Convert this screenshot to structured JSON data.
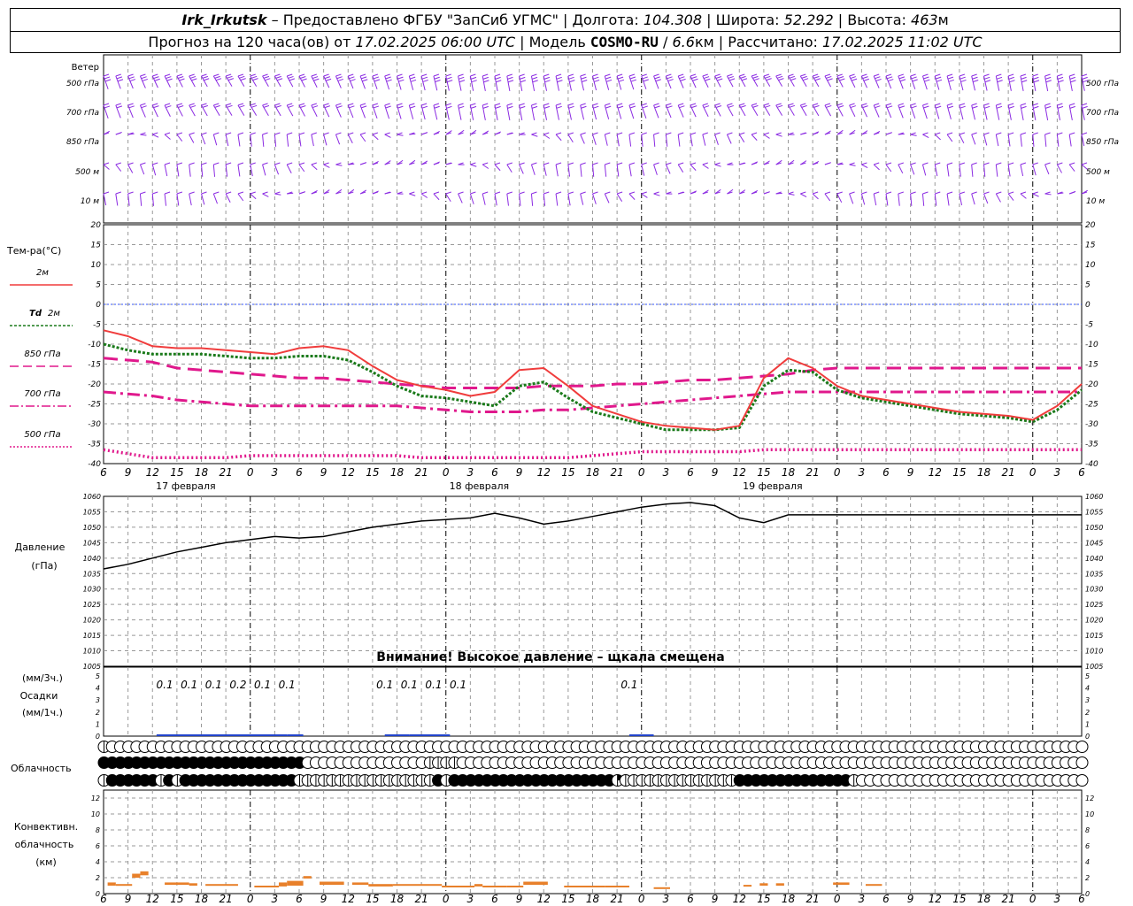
{
  "header": {
    "station": "Irk_Irkutsk",
    "provider": "Предоставлено ФГБУ \"ЗапСиб УГМС\"",
    "lon_label": "Долгота:",
    "lon": "104.308",
    "lat_label": "Широта:",
    "lat": "52.292",
    "alt_label": "Высота:",
    "alt": "463",
    "alt_unit": "м",
    "forecast_label": "Прогноз на 120 часа(ов) от",
    "forecast_time": "17.02.2025 06:00 UTC",
    "model_label": "Модель",
    "model": "COSMO-RU",
    "model_res": "6.6",
    "model_res_unit": "км",
    "calc_label": "Рассчитано:",
    "calc_time": "17.02.2025 11:02 UTC"
  },
  "colors": {
    "wind": "#8b2be2",
    "t2m": "#f03c3c",
    "td2m": "#1a7a1a",
    "t850": "#e0188c",
    "t700": "#e0188c",
    "t500": "#e0188c",
    "pressure": "#000000",
    "precip": "#2244cc",
    "conv": "#e8802a",
    "grid": "#999999",
    "zero": "#3355ff"
  },
  "chart_data": [
    {
      "type": "wind_barbs",
      "label": "Ветер",
      "levels": [
        "500 гПа",
        "700 гПа",
        "850 гПа",
        "500 м",
        "10   м"
      ]
    },
    {
      "type": "line",
      "title": "Тем-ра(°C)",
      "x_hours": [
        0,
        3,
        6,
        9,
        12,
        15,
        18,
        21,
        24,
        27,
        30,
        33,
        36,
        39,
        42,
        45,
        48,
        51,
        54,
        57,
        60,
        63,
        66,
        69,
        72,
        75,
        78,
        81,
        84,
        87,
        90,
        93,
        96,
        99,
        102,
        105,
        108,
        111,
        114,
        117,
        120
      ],
      "x_tick_labels": [
        "6",
        "9",
        "12",
        "15",
        "18",
        "21",
        "0",
        "3",
        "6",
        "9",
        "12",
        "15",
        "18",
        "21",
        "0",
        "3",
        "6",
        "9",
        "12",
        "15",
        "18",
        "21",
        "0",
        "3",
        "6",
        "9",
        "12",
        "15",
        "18",
        "21",
        "0",
        "3",
        "6",
        "9",
        "12",
        "15",
        "18",
        "21",
        "0",
        "3",
        "6",
        "9",
        "12"
      ],
      "date_labels": [
        "17 февраля",
        "18 февраля",
        "19 февраля"
      ],
      "ylim": [
        -40,
        20
      ],
      "y_ticks": [
        20,
        15,
        10,
        5,
        0,
        -5,
        -10,
        -15,
        -20,
        -25,
        -30,
        -35,
        -40
      ],
      "series": [
        {
          "name": "2м",
          "style": "solid",
          "values": [
            -6.5,
            -8,
            -10.5,
            -11,
            -11,
            -11.5,
            -12,
            -12.5,
            -11,
            -10.5,
            -11.5,
            -15.5,
            -19,
            -20.5,
            -21.5,
            -23,
            -22,
            -16.5,
            -16,
            -20.5,
            -25.5,
            -27.5,
            -29.5,
            -30.5,
            -31,
            -31.5,
            -30.5,
            -18.5,
            -13.5,
            -16,
            -20.5,
            -23,
            -24,
            -25,
            -26,
            -27,
            -27.5,
            -28,
            -29,
            -25.5,
            -20
          ]
        },
        {
          "name": "Td 2м",
          "style": "dotted",
          "values": [
            -10,
            -11.5,
            -12.5,
            -12.5,
            -12.5,
            -13,
            -13.5,
            -13.5,
            -13,
            -13,
            -14,
            -17,
            -20.5,
            -23,
            -23.5,
            -24.5,
            -25.5,
            -20.5,
            -19.5,
            -23.5,
            -27,
            -28.5,
            -30,
            -31.5,
            -31.5,
            -31.5,
            -31,
            -20.5,
            -16.5,
            -17,
            -21.5,
            -23.5,
            -24.5,
            -25.5,
            -26.5,
            -27.5,
            -28,
            -28.5,
            -29.5,
            -26.5,
            -21.5
          ]
        },
        {
          "name": "850 гПа",
          "style": "dashed",
          "values": [
            -13.5,
            -14,
            -14.5,
            -16,
            -16.5,
            -17,
            -17.5,
            -18,
            -18.5,
            -18.5,
            -19,
            -19.5,
            -20,
            -20.5,
            -21,
            -21,
            -21,
            -21,
            -20.5,
            -20.5,
            -20.5,
            -20,
            -20,
            -19.5,
            -19,
            -19,
            -18.5,
            -18,
            -17.5,
            -16.5,
            -16,
            -16,
            -16,
            -16,
            -16,
            -16,
            -16,
            -16,
            -16,
            -16,
            -16
          ]
        },
        {
          "name": "700 гПа",
          "style": "dashdot",
          "values": [
            -22,
            -22.5,
            -23,
            -24,
            -24.5,
            -25,
            -25.5,
            -25.5,
            -25.5,
            -25.5,
            -25.5,
            -25.5,
            -25.5,
            -26,
            -26.5,
            -27,
            -27,
            -27,
            -26.5,
            -26.5,
            -26,
            -25.5,
            -25,
            -24.5,
            -24,
            -23.5,
            -23,
            -22.5,
            -22,
            -22,
            -22,
            -22,
            -22,
            -22,
            -22,
            -22,
            -22,
            -22,
            -22,
            -22,
            -22
          ]
        },
        {
          "name": "500 гПа",
          "style": "dotted-thick",
          "values": [
            -36.5,
            -37.5,
            -38.5,
            -38.5,
            -38.5,
            -38.5,
            -38,
            -38,
            -38,
            -38,
            -38,
            -38,
            -38,
            -38.5,
            -38.5,
            -38.5,
            -38.5,
            -38.5,
            -38.5,
            -38.5,
            -38,
            -37.5,
            -37,
            -37,
            -37,
            -37,
            -37,
            -36.5,
            -36.5,
            -36.5,
            -36.5,
            -36.5,
            -36.5,
            -36.5,
            -36.5,
            -36.5,
            -36.5,
            -36.5,
            -36.5,
            -36.5,
            -36.5
          ]
        }
      ]
    },
    {
      "type": "line",
      "title_lines": [
        "Давление",
        "(гПа)"
      ],
      "ylim": [
        1005,
        1060
      ],
      "y_ticks": [
        1060,
        1055,
        1050,
        1045,
        1040,
        1035,
        1030,
        1025,
        1020,
        1015,
        1010,
        1005
      ],
      "warning": "Внимание! Высокое давление – щкала смещена",
      "series": [
        {
          "name": "",
          "values": [
            1036.5,
            1038,
            1040,
            1042,
            1043.5,
            1045,
            1046,
            1047,
            1046.5,
            1047,
            1048.5,
            1050,
            1051,
            1052,
            1052.5,
            1053,
            1054.5,
            1053,
            1051,
            1052,
            1053.5,
            1055,
            1056.5,
            1057.5,
            1058,
            1057,
            1053,
            1051.5,
            1054,
            1054,
            1054,
            1054,
            1054,
            1054,
            1054,
            1054,
            1054,
            1054,
            1054,
            1054,
            1054
          ]
        }
      ]
    },
    {
      "type": "bar",
      "title_lines": [
        "(мм/3ч.)",
        "Осадки",
        "(мм/1ч.)"
      ],
      "ylim": [
        0,
        5
      ],
      "y_ticks": [
        5,
        4,
        3,
        2,
        1,
        0
      ],
      "sums_3h": [
        {
          "hour": 7.5,
          "value": "0.1"
        },
        {
          "hour": 10.5,
          "value": "0.1"
        },
        {
          "hour": 13.5,
          "value": "0.1"
        },
        {
          "hour": 16.5,
          "value": "0.2"
        },
        {
          "hour": 19.5,
          "value": "0.1"
        },
        {
          "hour": 22.5,
          "value": "0.1"
        },
        {
          "hour": 34.5,
          "value": "0.1"
        },
        {
          "hour": 37.5,
          "value": "0.1"
        },
        {
          "hour": 40.5,
          "value": "0.1"
        },
        {
          "hour": 43.5,
          "value": "0.1"
        },
        {
          "hour": 64.5,
          "value": "0.1"
        }
      ],
      "hourly": [
        [
          6,
          22,
          0.06
        ],
        [
          22,
          24,
          0.03
        ],
        [
          34,
          37,
          0.06
        ],
        [
          37,
          42,
          0.03
        ],
        [
          64,
          67,
          0.03
        ]
      ]
    },
    {
      "type": "cloud_symbols",
      "title": "Облачность",
      "rows": [
        "10000000000000000000000000000000000000000000000000000000000000000000000000000000000000000000000000000000000000000000000000",
        "33333333333333333333333330000000000000001111000000000000000000000000000000000000000000000000000000000000000000000000000000",
        "13333331313333333333333311111111111111111313333333333333333333321111111111111133333333333333100000000000000000000000000000"
      ]
    },
    {
      "type": "bar",
      "title_lines": [
        "Конвективн.",
        "облачность",
        "(км)"
      ],
      "ylim": [
        0,
        13
      ],
      "y_ticks": [
        12,
        10,
        8,
        6,
        4,
        2,
        0
      ],
      "layers": [
        [
          0.5,
          1.5,
          1.0,
          1.4
        ],
        [
          1.5,
          3.5,
          1.0,
          1.2
        ],
        [
          3.5,
          4.5,
          2.0,
          2.5
        ],
        [
          4.5,
          5.5,
          2.3,
          2.8
        ],
        [
          7.5,
          10.5,
          1.1,
          1.4
        ],
        [
          10.5,
          11.5,
          1.0,
          1.3
        ],
        [
          12.5,
          16.5,
          1.0,
          1.2
        ],
        [
          18.5,
          21.5,
          0.9,
          1.0
        ],
        [
          21.5,
          22.5,
          0.9,
          1.4
        ],
        [
          22.5,
          24.5,
          1.0,
          1.6
        ],
        [
          24.5,
          25.5,
          1.9,
          2.2
        ],
        [
          26.5,
          29.5,
          1.1,
          1.5
        ],
        [
          30.5,
          32.5,
          1.1,
          1.4
        ],
        [
          32.5,
          35.5,
          0.9,
          1.2
        ],
        [
          35.5,
          41.5,
          1.0,
          1.2
        ],
        [
          41.5,
          45.5,
          0.8,
          1.0
        ],
        [
          45.5,
          46.5,
          0.9,
          1.2
        ],
        [
          46.5,
          49.5,
          0.8,
          1.0
        ],
        [
          49.5,
          51.5,
          0.8,
          1.0
        ],
        [
          51.5,
          54.5,
          1.1,
          1.5
        ],
        [
          56.5,
          61.5,
          0.8,
          1.0
        ],
        [
          61.5,
          64.5,
          0.8,
          1.0
        ],
        [
          67.5,
          69.5,
          0.7,
          0.8
        ],
        [
          78.5,
          79.5,
          0.9,
          1.1
        ],
        [
          80.5,
          81.5,
          1.0,
          1.3
        ],
        [
          82.5,
          83.5,
          1.0,
          1.3
        ],
        [
          89.5,
          91.5,
          1.1,
          1.4
        ],
        [
          93.5,
          95.5,
          1.0,
          1.2
        ]
      ]
    }
  ]
}
